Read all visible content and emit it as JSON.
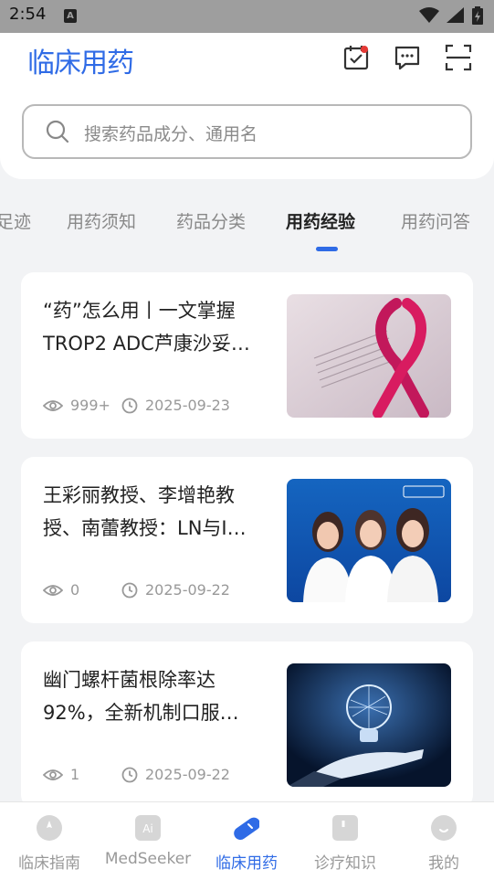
{
  "status_bar": {
    "time": "2:54",
    "indicator": "A"
  },
  "header": {
    "logo": "临床用药",
    "icons": [
      "calendar-check-icon",
      "message-icon",
      "scan-icon"
    ]
  },
  "search": {
    "placeholder": "搜索药品成分、通用名"
  },
  "tabs": [
    {
      "label": "足迹"
    },
    {
      "label": "用药须知"
    },
    {
      "label": "药品分类"
    },
    {
      "label": "用药经验",
      "active": true
    },
    {
      "label": "用药问答"
    }
  ],
  "articles": [
    {
      "title": "“药”怎么用丨一文掌握TROP2 ADC芦康沙妥…",
      "views": "999+",
      "date": "2025-09-23"
    },
    {
      "title": "王彩丽教授、李增艳教授、南蕾教授：LN与I…",
      "views": "0",
      "date": "2025-09-22"
    },
    {
      "title": "幽门螺杆菌根除率达92%，全新机制口服…",
      "views": "1",
      "date": "2025-09-22"
    }
  ],
  "bottom_nav": [
    {
      "label": "临床指南"
    },
    {
      "label": "MedSeeker"
    },
    {
      "label": "临床用药",
      "active": true
    },
    {
      "label": "诊疗知识"
    },
    {
      "label": "我的"
    }
  ],
  "colors": {
    "accent": "#2f6be6",
    "background": "#f2f3f5"
  }
}
